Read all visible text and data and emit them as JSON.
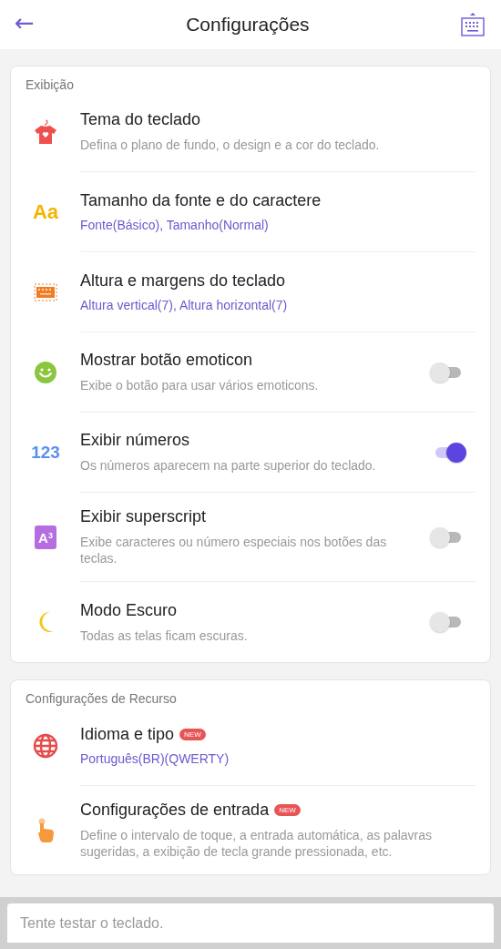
{
  "header": {
    "back": "←",
    "title": "Configurações"
  },
  "sections": [
    {
      "label": "Exibição",
      "items": [
        {
          "kind": "shirt",
          "title": "Tema do teclado",
          "description": "Defina o plano de fundo, o design e a cor do teclado."
        },
        {
          "kind": "text",
          "icon_text": "Aa",
          "title": "Tamanho da fonte e do caractere",
          "value": "Fonte(Básico), Tamanho(Normal)"
        },
        {
          "kind": "keyboard",
          "title": "Altura e margens do teclado",
          "value": "Altura vertical(7), Altura horizontal(7)"
        },
        {
          "kind": "smiley",
          "title": "Mostrar botão emoticon",
          "description": "Exibe o botão para usar vários emoticons.",
          "on": false
        },
        {
          "kind": "digits",
          "icon_text": "123",
          "title": "Exibir números",
          "description": "Os números aparecem na parte superior do teclado.",
          "on": true
        },
        {
          "kind": "superscript",
          "icon_text": "A$^{3}$",
          "title": "Exibir superscript",
          "description": "Exibe caracteres ou número especiais nos botões das teclas.",
          "on": false
        },
        {
          "kind": "moon",
          "title": "Modo Escuro",
          "description": "Todas as telas ficam escuras.",
          "on": false
        }
      ]
    },
    {
      "label": "Configurações de Recurso",
      "items": [
        {
          "kind": "globe",
          "title": "Idioma e tipo",
          "badge": "NEW",
          "value": "Português(BR)(QWERTY)"
        },
        {
          "kind": "hand",
          "title": "Configurações de entrada",
          "badge": "NEW",
          "description": "Define o intervalo de toque, a entrada automática, as palavras sugeridas, a exibição de tecla grande pressionada, etc."
        }
      ]
    }
  ],
  "test_field": {
    "placeholder": "Tente testar o teclado."
  }
}
